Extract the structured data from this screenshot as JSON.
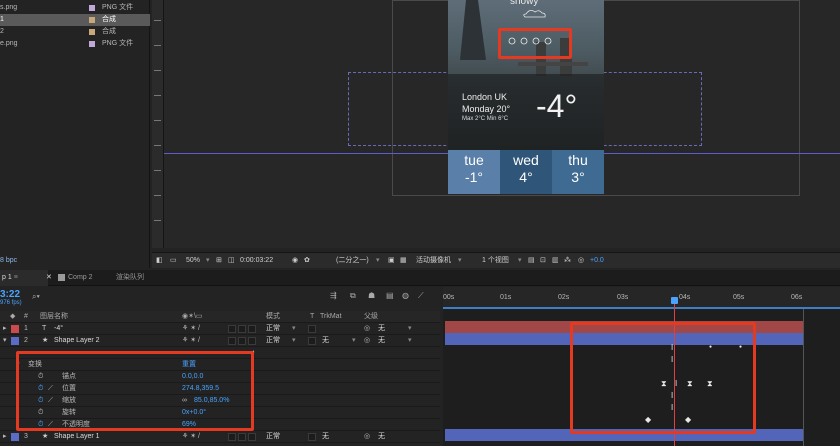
{
  "project": {
    "items": [
      {
        "name": "s.png",
        "type": "PNG 文件",
        "color": "#c0a8d8",
        "selected": false
      },
      {
        "name": "1",
        "type": "合成",
        "color": "#c8a77a",
        "selected": true
      },
      {
        "name": "2",
        "type": "合成",
        "color": "#c8a77a",
        "selected": false
      },
      {
        "name": "e.png",
        "type": "PNG 文件",
        "color": "#c0a8d8",
        "selected": false
      }
    ],
    "bpc": "8 bpc"
  },
  "phone": {
    "condition": "snowy",
    "city": "London UK",
    "date": "Monday 20°",
    "minmax": "Max 2°C  Min 6°C",
    "temp": "-4°",
    "days": [
      {
        "name": "tue",
        "temp": "-1°",
        "color": "#5a7fa8"
      },
      {
        "name": "wed",
        "temp": "4°",
        "color": "#2f5678"
      },
      {
        "name": "thu",
        "temp": "3°",
        "color": "#3f6a92"
      }
    ]
  },
  "viewer_toolbar": {
    "zoom": "50%",
    "timecode": "0:00:03:22",
    "resolution": "(二分之一)",
    "camera": "活动摄像机",
    "views": "1 个视图",
    "exposure": "+0.0"
  },
  "tabs": [
    {
      "label": "p 1",
      "active": true
    },
    {
      "label": "Comp 2",
      "active": false
    },
    {
      "label": "渲染队列",
      "active": false
    }
  ],
  "timeline": {
    "time": "3:22",
    "fps": "976 fps)",
    "columns": {
      "num": "#",
      "name": "图层名称",
      "mode": "模式",
      "t": "T",
      "trkmat": "TrkMat",
      "parent": "父级"
    },
    "ruler": [
      "00s",
      "01s",
      "02s",
      "03s",
      "04s",
      "05s",
      "06s"
    ],
    "layers": [
      {
        "num": "1",
        "name": "-4°",
        "mode": "正常",
        "trk": "",
        "parent": "无",
        "color": "#c94b4b"
      },
      {
        "num": "2",
        "name": "Shape Layer 2",
        "mode": "正常",
        "trk": "无",
        "parent": "无",
        "color": "#5b6cc7"
      }
    ],
    "transform": {
      "group": "变换",
      "reset": "重置",
      "props": [
        {
          "name": "锚点",
          "value": "0.0,0.0"
        },
        {
          "name": "位置",
          "value": "274.8,359.5"
        },
        {
          "name": "缩放",
          "value": "85.0,85.0%"
        },
        {
          "name": "旋转",
          "value": "0x+0.0°"
        },
        {
          "name": "不透明度",
          "value": "69%"
        }
      ]
    },
    "layer3": {
      "num": "3",
      "name": "Shape Layer 1",
      "mode": "正常",
      "trk": "无",
      "parent": "无"
    }
  }
}
